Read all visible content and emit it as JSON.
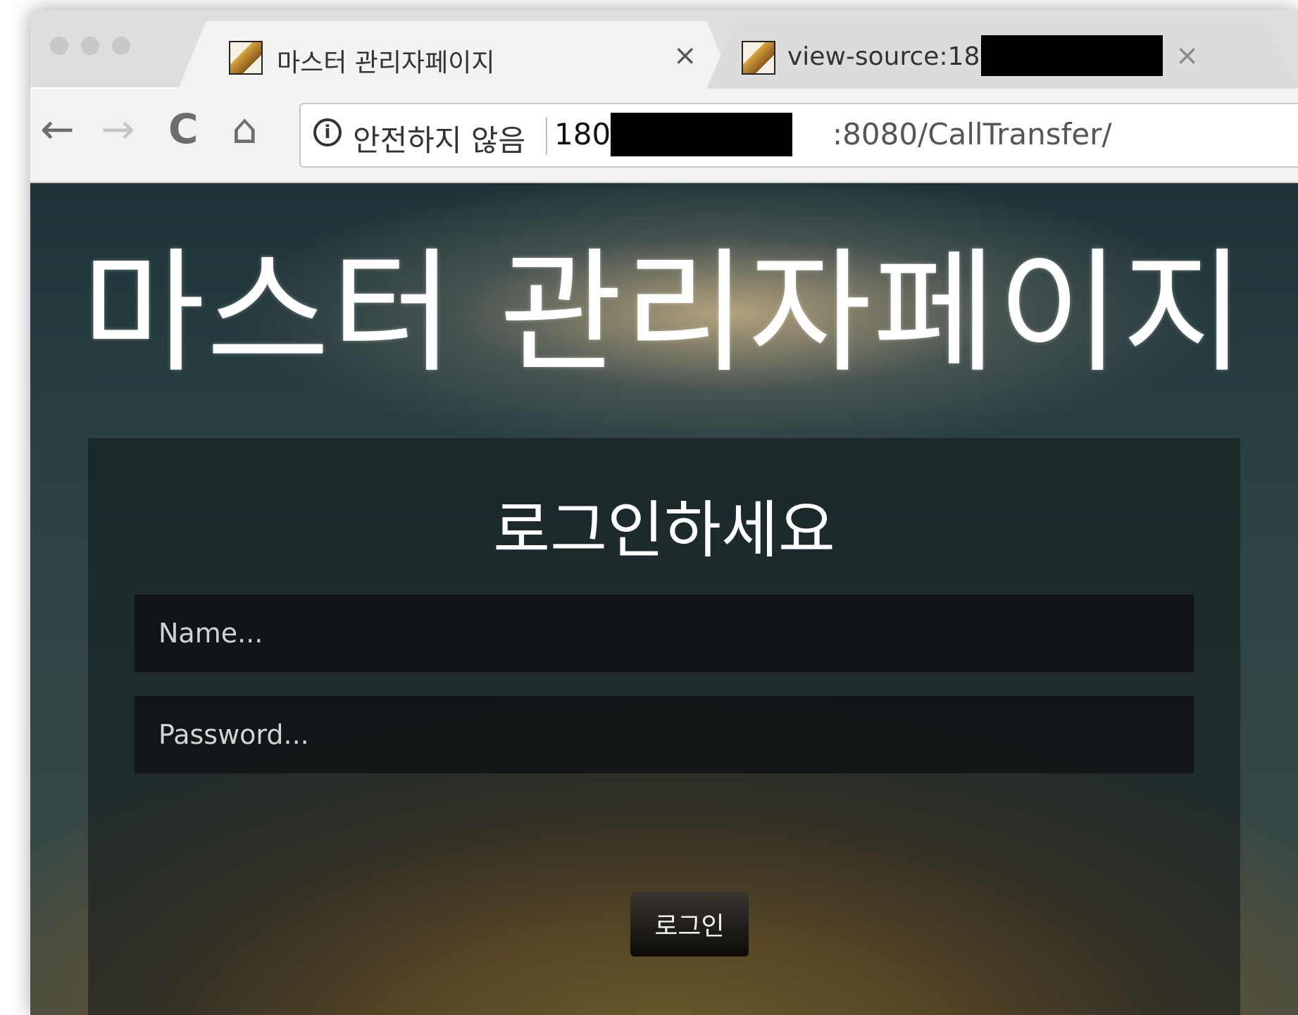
{
  "browser": {
    "tabs": [
      {
        "title": "마스터 관리자페이지",
        "close": "×",
        "favicon": "tomcat-icon"
      },
      {
        "title": "view-source:180.",
        "close": "×",
        "favicon": "tomcat-icon"
      }
    ],
    "nav": {
      "back": "←",
      "forward": "→",
      "reload": "C",
      "home": "⌂"
    },
    "omnibox": {
      "info_icon": "i",
      "security_label": "안전하지 않음",
      "host_prefix": "180",
      "path": ":8080/CallTransfer/"
    }
  },
  "page": {
    "title": "마스터 관리자페이지",
    "login": {
      "heading": "로그인하세요",
      "name_placeholder": "Name...",
      "password_placeholder": "Password...",
      "button_label": "로그인"
    }
  }
}
